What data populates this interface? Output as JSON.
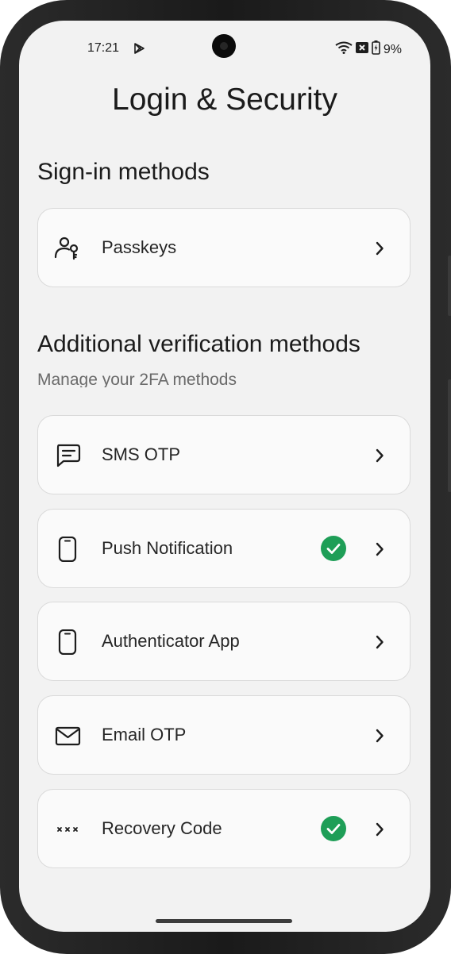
{
  "status_bar": {
    "time": "17:21",
    "battery_percent": "9%",
    "icons": [
      "play-icon",
      "wifi-icon",
      "notification-x-icon",
      "battery-charging-icon"
    ]
  },
  "page": {
    "title": "Login & Security"
  },
  "sign_in": {
    "title": "Sign-in methods",
    "items": [
      {
        "label": "Passkeys",
        "icon": "passkey-icon",
        "verified": false
      }
    ]
  },
  "additional": {
    "title": "Additional verification methods",
    "subtitle": "Manage your 2FA methods",
    "items": [
      {
        "label": "SMS OTP",
        "icon": "chat-icon",
        "verified": false
      },
      {
        "label": "Push Notification",
        "icon": "phone-icon",
        "verified": true
      },
      {
        "label": "Authenticator App",
        "icon": "phone-icon",
        "verified": false
      },
      {
        "label": "Email OTP",
        "icon": "mail-icon",
        "verified": false
      },
      {
        "label": "Recovery Code",
        "icon": "password-dots-icon",
        "verified": true
      }
    ]
  },
  "colors": {
    "background": "#f2f2f2",
    "card": "#fafafa",
    "verified": "#1e9e57",
    "text": "#1b1b1b"
  }
}
